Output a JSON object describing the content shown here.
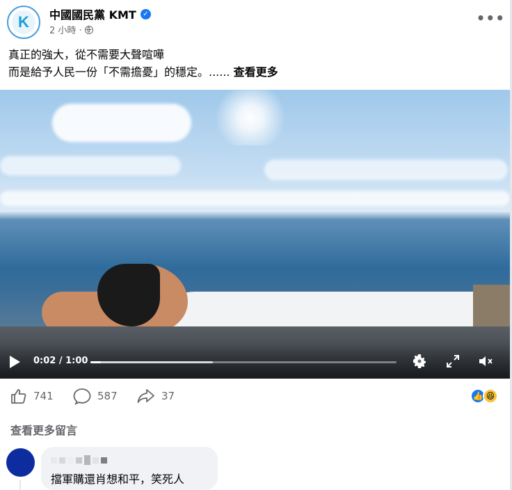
{
  "post": {
    "page_name": "中國國民黨 KMT",
    "avatar_letter": "K",
    "time": "2 小時 ·",
    "text_line1": "真正的強大，從不需要大聲喧嘩",
    "text_line2": "而是給予人民一份「不需擔憂」的穩定。......",
    "see_more": "查看更多"
  },
  "video": {
    "time_display": "0:02 / 1:00",
    "progress_fraction": 0.033,
    "buffered_fraction": 0.4
  },
  "actions": {
    "likes": "741",
    "comments": "587",
    "shares": "37"
  },
  "view_more_comments": "查看更多留言",
  "comment": {
    "text": "擋軍購還肖想和平，笑死人"
  },
  "colors": {
    "brand_blue": "#1877f2",
    "secondary_text": "#65676b",
    "comment_avatar": "#0d2c9e"
  }
}
